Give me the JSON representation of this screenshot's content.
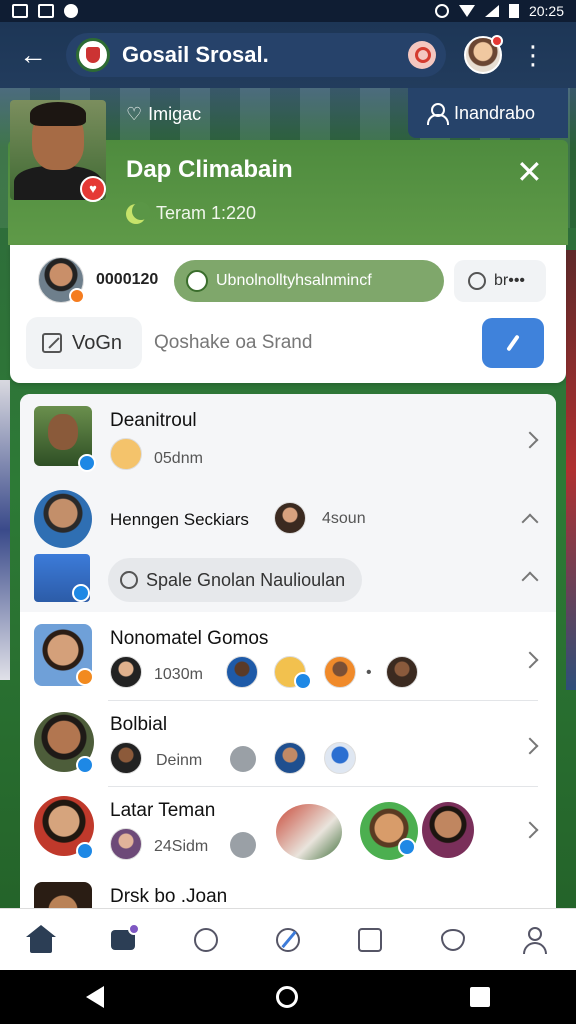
{
  "status_bar": {
    "time": "20:25"
  },
  "app_bar": {
    "title": "Gosail Srosal."
  },
  "top_action": {
    "label": "Inandrabo"
  },
  "match": {
    "tag": "Imigac",
    "title": "Dap Climabain",
    "subtitle": "Teram 1:220"
  },
  "composer": {
    "name": "0000120",
    "chip_text": "Ubnolnolltyhsalnmincf",
    "more_label": "br•••",
    "action_label": "VoGn",
    "input_placeholder": "Qoshake oa Srand"
  },
  "list": [
    {
      "title": "Deanitroul",
      "sub": "05dnm"
    },
    {
      "title": "Henngen Seckiars",
      "sub": "4soun"
    },
    {
      "pill_label": "Spale Gnolan Naulioulan"
    },
    {
      "title": "Nonomatel Gomos",
      "sub": "1030m",
      "extra": "•"
    },
    {
      "title": "Bolbial",
      "sub": "Deinm"
    },
    {
      "title": "Latar Teman",
      "sub": "24Sidm"
    },
    {
      "title": "Drsk bo .Joan"
    }
  ],
  "icons": {
    "back": "arrow-left",
    "search": "search",
    "more": "vertical-dots",
    "close": "x",
    "heart": "heart",
    "send": "pen"
  },
  "colors": {
    "app_bar": "#1d3656",
    "match_card": "#5a9646",
    "chip": "#7fa76b",
    "send_button": "#3f82db",
    "badge_blue": "#1e88e5",
    "badge_orange": "#f28a1f",
    "badge_red": "#e53935"
  }
}
